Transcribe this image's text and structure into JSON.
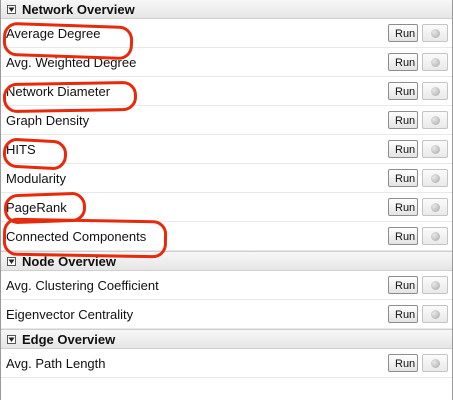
{
  "sections": [
    {
      "title": "Network Overview",
      "rows": [
        {
          "label": "Average Degree",
          "button": "Run"
        },
        {
          "label": "Avg. Weighted Degree",
          "button": "Run"
        },
        {
          "label": "Network Diameter",
          "button": "Run"
        },
        {
          "label": "Graph Density",
          "button": "Run"
        },
        {
          "label": "HITS",
          "button": "Run"
        },
        {
          "label": "Modularity",
          "button": "Run"
        },
        {
          "label": "PageRank",
          "button": "Run"
        },
        {
          "label": "Connected Components",
          "button": "Run"
        }
      ]
    },
    {
      "title": "Node Overview",
      "rows": [
        {
          "label": "Avg. Clustering Coefficient",
          "button": "Run"
        },
        {
          "label": "Eigenvector Centrality",
          "button": "Run"
        }
      ]
    },
    {
      "title": "Edge Overview",
      "rows": [
        {
          "label": "Avg. Path Length",
          "button": "Run"
        }
      ]
    }
  ],
  "annotation_color": "#e8290c",
  "highlighted_items": [
    "Average Degree",
    "Network Diameter",
    "HITS",
    "PageRank",
    "Connected Components"
  ]
}
